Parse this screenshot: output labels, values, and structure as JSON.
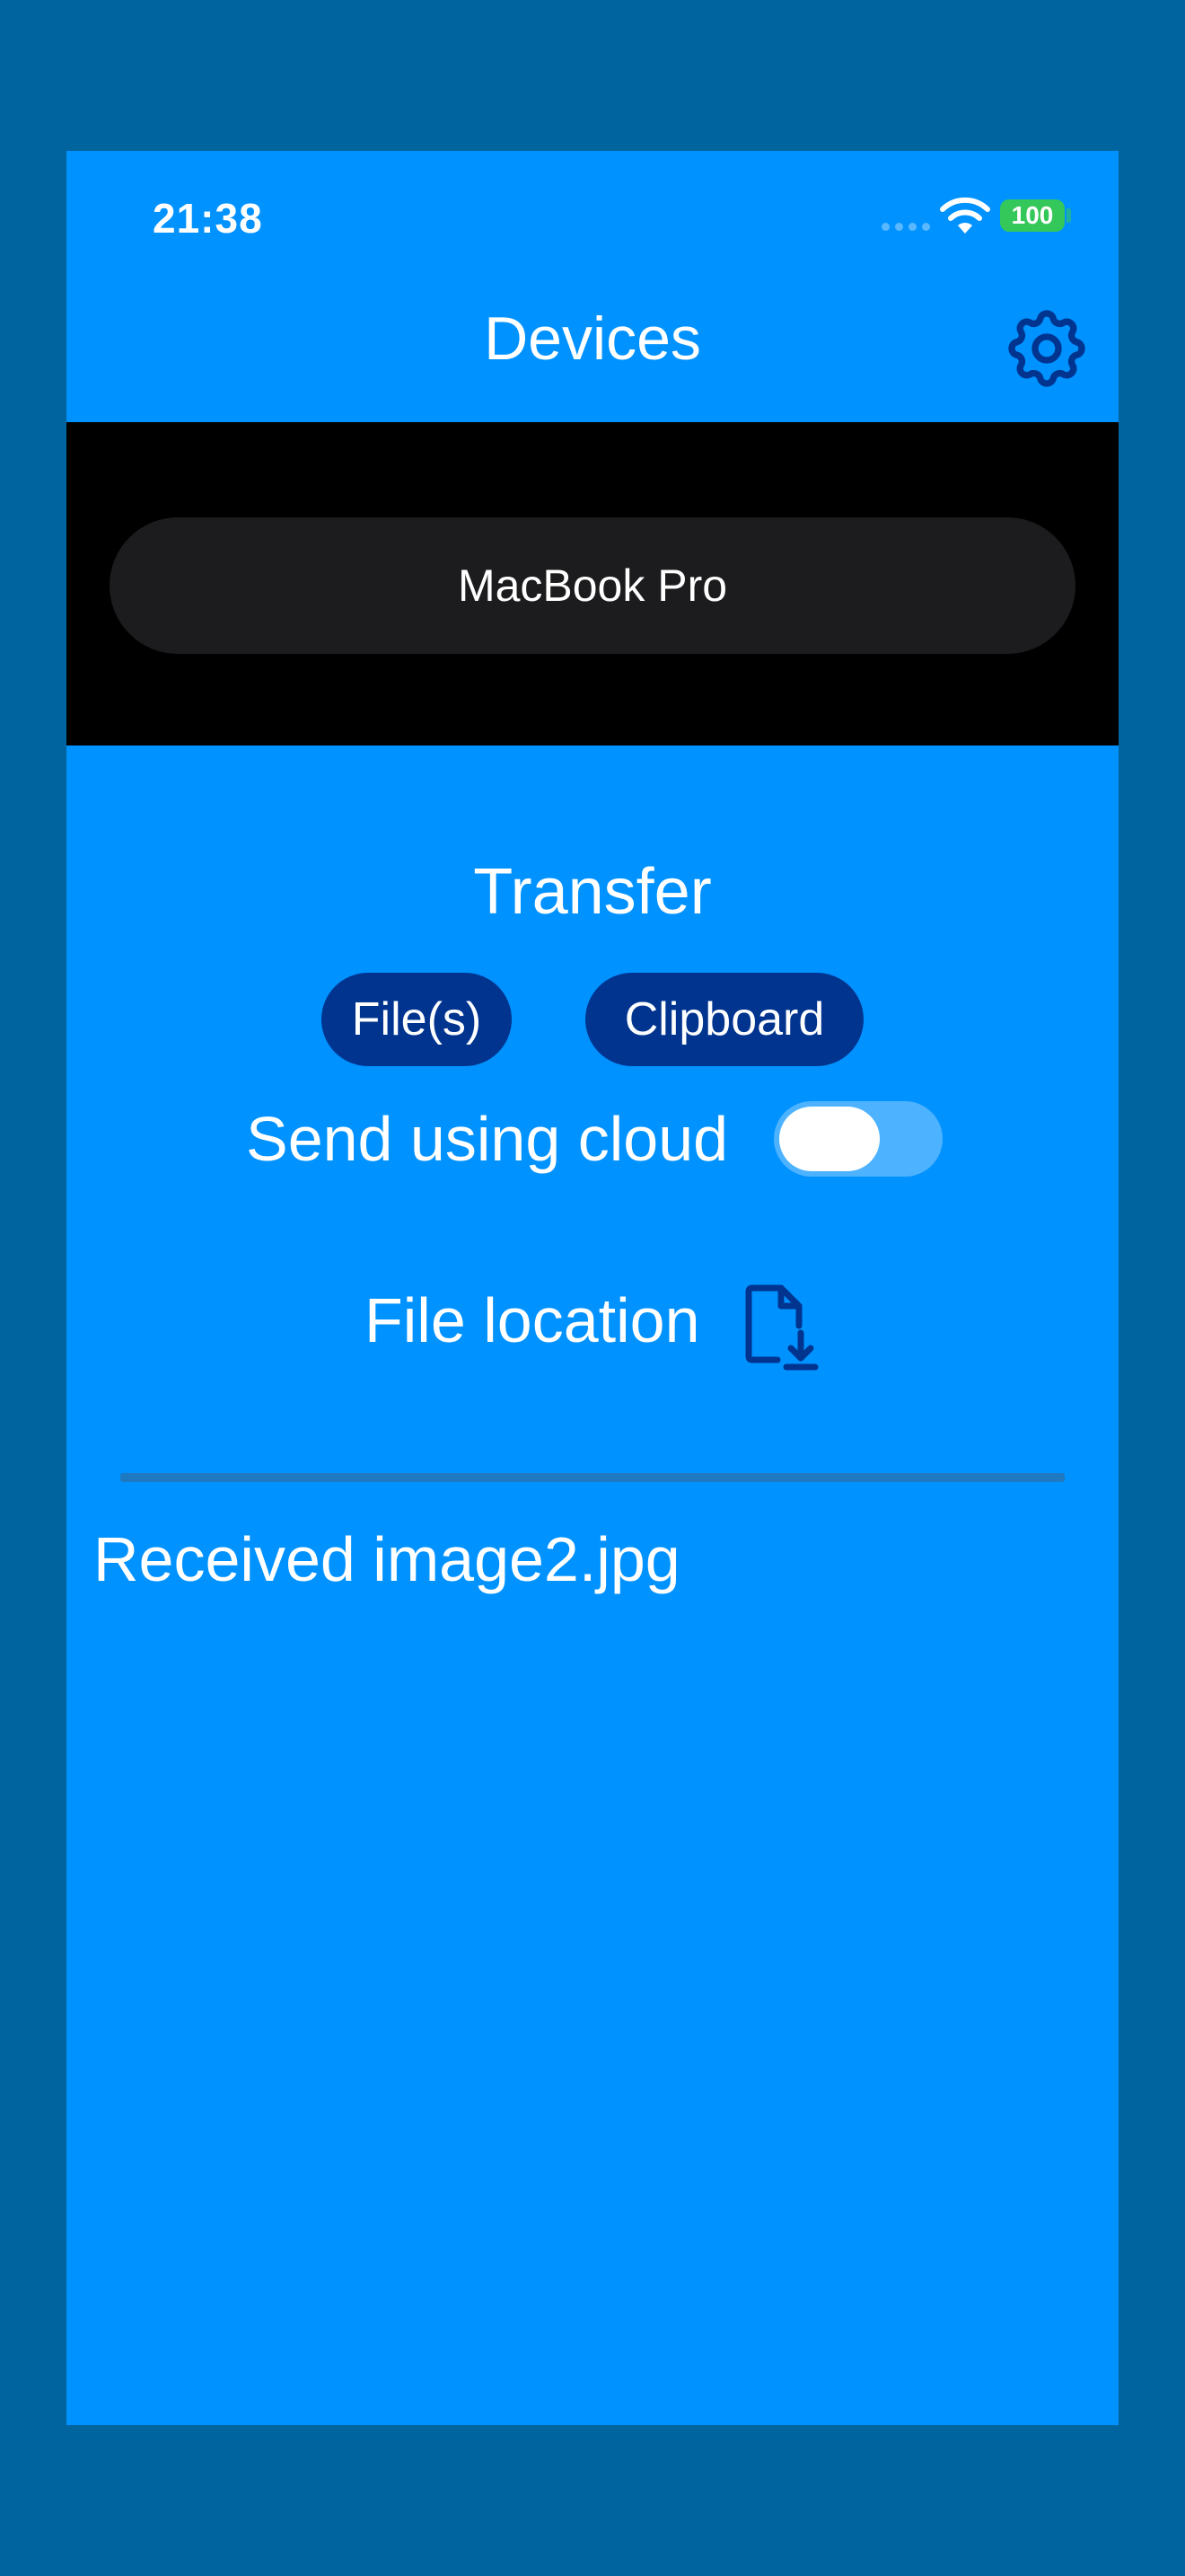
{
  "status_bar": {
    "time": "21:38",
    "battery": "100"
  },
  "header": {
    "title": "Devices"
  },
  "devices": {
    "selected": "MacBook Pro"
  },
  "transfer": {
    "heading": "Transfer",
    "files_label": "File(s)",
    "clipboard_label": "Clipboard",
    "cloud_label": "Send using cloud",
    "cloud_enabled": false,
    "file_location_label": "File location"
  },
  "log": {
    "entries": [
      "Received image2.jpg"
    ]
  },
  "icons": {
    "settings": "gear-icon",
    "file_location": "file-download-icon",
    "wifi": "wifi-icon"
  },
  "colors": {
    "page_background": "#00649e",
    "app_background": "#0092ff",
    "device_panel": "#000000",
    "device_button": "#1c1c1e",
    "pill_button": "#00348f",
    "toggle_track": "#4db2ff",
    "icon": "#00348f",
    "battery": "#34c759"
  }
}
